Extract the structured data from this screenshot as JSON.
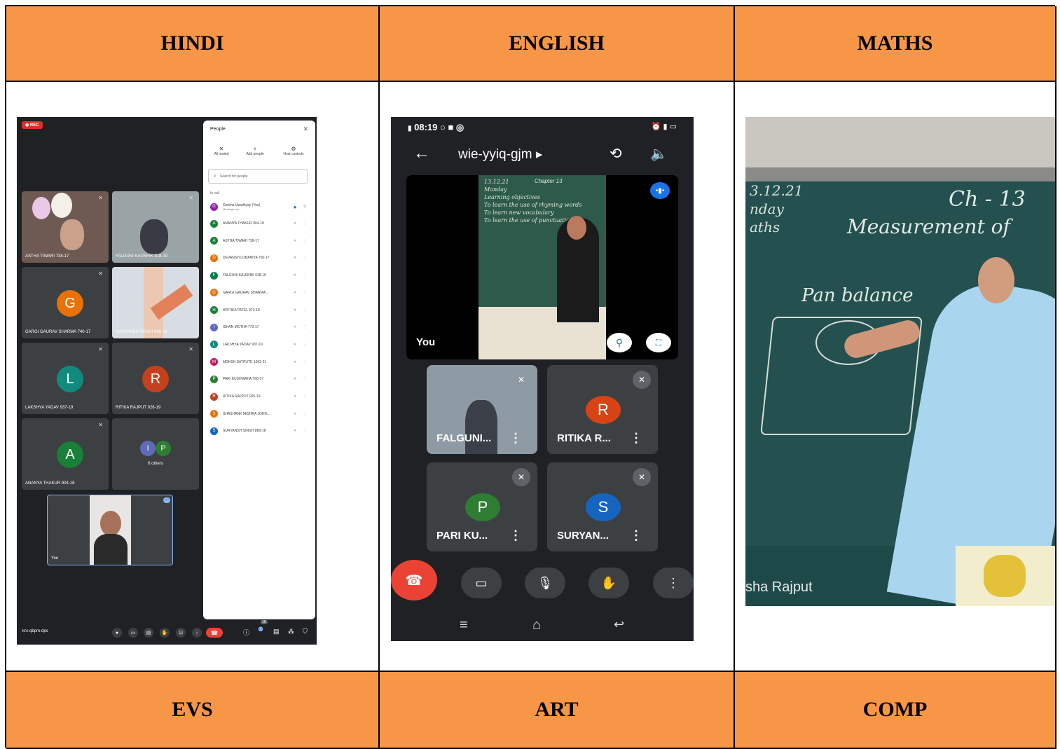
{
  "headers_top": [
    "HINDI",
    "ENGLISH",
    "MATHS"
  ],
  "headers_bottom": [
    "EVS",
    "ART",
    "COMP"
  ],
  "hindi": {
    "rec_label": "REC",
    "tiles": [
      {
        "name": "ASTHA TIWARI 738-17"
      },
      {
        "name": "FALGUNI KAUSHIK 918-19"
      },
      {
        "name": "GARGI GAURAV SHARMA 740-17",
        "initial": "G"
      },
      {
        "name": "SURYANSH SINGH 880-18"
      },
      {
        "name": "LAKSHYA YADAV 937-19",
        "initial": "L"
      },
      {
        "name": "RITIKA RAJPUT 926-19",
        "initial": "R"
      },
      {
        "name": "ANANYA THAKUR 904-18",
        "initial": "A"
      },
      {
        "name": "6 others",
        "initial1": "I",
        "initial2": "P"
      }
    ],
    "self_label": "You",
    "meeting_code": "krx-qbpm-dps",
    "people_count": "16",
    "panel": {
      "title": "People",
      "all_muted": "All muted",
      "add_people": "Add people",
      "host_controls": "Host controls",
      "search_placeholder": "Search for people",
      "in_call": "In call",
      "host_name": "Garima Upadhyay (You)",
      "host_role": "Meeting host",
      "people": [
        {
          "i": "A",
          "name": "ANANYA THAKUR 904-18"
        },
        {
          "i": "A",
          "name": "ASTHA TIWARI 738-17"
        },
        {
          "i": "D",
          "name": "DEVANSH LOBANIYA 760-17"
        },
        {
          "i": "F",
          "name": "FALGUNI KAUSHIK 918-19"
        },
        {
          "i": "G",
          "name": "GARGI GAURAV SHARMA..."
        },
        {
          "i": "H",
          "name": "HRITIKA PATEL 973-19"
        },
        {
          "i": "I",
          "name": "ISHAN MOTHA 773-17"
        },
        {
          "i": "L",
          "name": "LAKSHYA YADAV 937-19"
        },
        {
          "i": "M",
          "name": "MOKSH SATPUTE 1003-21"
        },
        {
          "i": "P",
          "name": "PARI KUSHWAHA 760-17"
        },
        {
          "i": "R",
          "name": "RITIKA RAJPUT 926-19"
        },
        {
          "i": "S",
          "name": "SHASHANK MISHRA JOHO..."
        },
        {
          "i": "S",
          "name": "SURYANSH SINGH 880-18"
        }
      ]
    }
  },
  "english": {
    "status_time": "08:19",
    "meeting_code": "wie-yyiq-gjm ▸",
    "self_label": "You",
    "board_text": [
      "13.12.21",
      "Monday",
      "Chapter 13",
      "Learning objectives",
      "To learn the use of rhyming words",
      "To learn new vocabulary",
      "To learn the use of punctuation"
    ],
    "tiles": [
      {
        "name": "FALGUNI..."
      },
      {
        "name": "RITIKA R...",
        "initial": "R"
      },
      {
        "name": "PARI KU...",
        "initial": "P"
      },
      {
        "name": "SURYAN...",
        "initial": "S"
      }
    ]
  },
  "maths": {
    "board_date": "3.12.21",
    "board_day": "nday",
    "board_subject": "aths",
    "board_chapter": "Ch - 13",
    "board_title": "Measurement of",
    "board_topic": "Pan balance",
    "caption": "sha Rajput"
  },
  "colors": {
    "header": "#f79646",
    "meet_bg": "#202124",
    "end_call": "#ea4335"
  }
}
